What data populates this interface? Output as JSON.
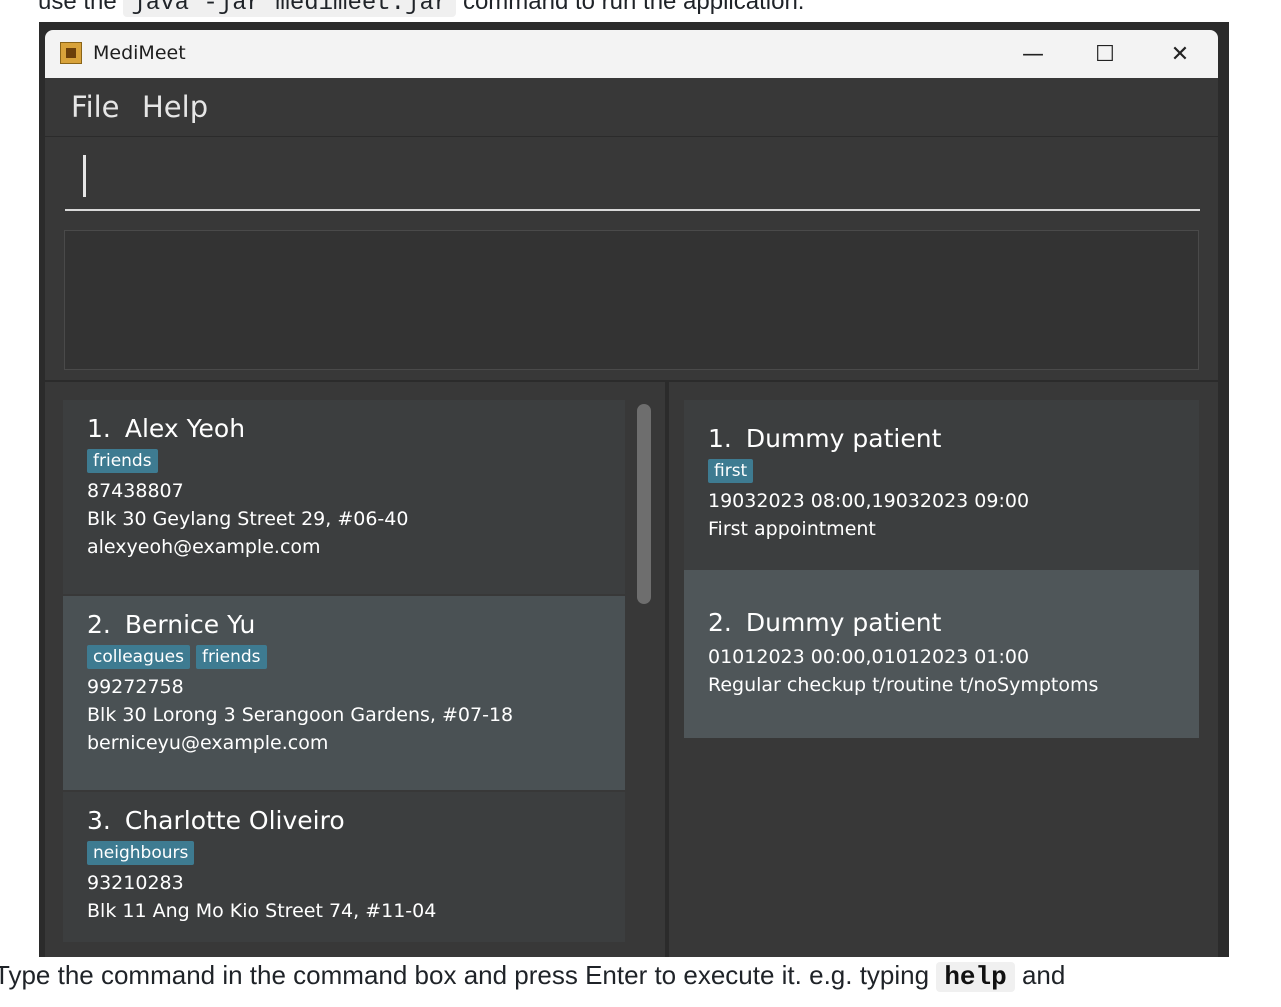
{
  "doc": {
    "top_before": "use the",
    "top_code": "java -jar medimeet.jar",
    "top_after": "command to run the application.",
    "bottom_before": "Type the command in the command box and press Enter to execute it. e.g. typing",
    "bottom_code": "help",
    "bottom_after": "and"
  },
  "window": {
    "title": "MediMeet",
    "minimize_glyph": "—",
    "maximize_glyph": "☐",
    "close_glyph": "✕"
  },
  "menu": {
    "file": "File",
    "help": "Help"
  },
  "command_box": {
    "value": ""
  },
  "result_display": {
    "text": ""
  },
  "persons": [
    {
      "index": "1.",
      "name": "Alex Yeoh",
      "tags": [
        "friends"
      ],
      "phone": "87438807",
      "address": "Blk 30 Geylang Street 29, #06-40",
      "email": "alexyeoh@example.com"
    },
    {
      "index": "2.",
      "name": "Bernice Yu",
      "tags": [
        "colleagues",
        "friends"
      ],
      "phone": "99272758",
      "address": "Blk 30 Lorong 3 Serangoon Gardens, #07-18",
      "email": "berniceyu@example.com"
    },
    {
      "index": "3.",
      "name": "Charlotte Oliveiro",
      "tags": [
        "neighbours"
      ],
      "phone": "93210283",
      "address": "Blk 11 Ang Mo Kio Street 74, #11-04",
      "email": ""
    }
  ],
  "appointments": [
    {
      "index": "1.",
      "name": "Dummy patient",
      "tags": [
        "first"
      ],
      "time": "19032023 08:00,19032023 09:00",
      "description": "First appointment"
    },
    {
      "index": "2.",
      "name": "Dummy patient",
      "tags": [],
      "time": "01012023 00:00,01012023 01:00",
      "description": "Regular checkup t/routine t/noSymptoms"
    }
  ],
  "colors": {
    "tag": "#3e7b91",
    "background": "#383838",
    "selected": "#4a5154"
  }
}
